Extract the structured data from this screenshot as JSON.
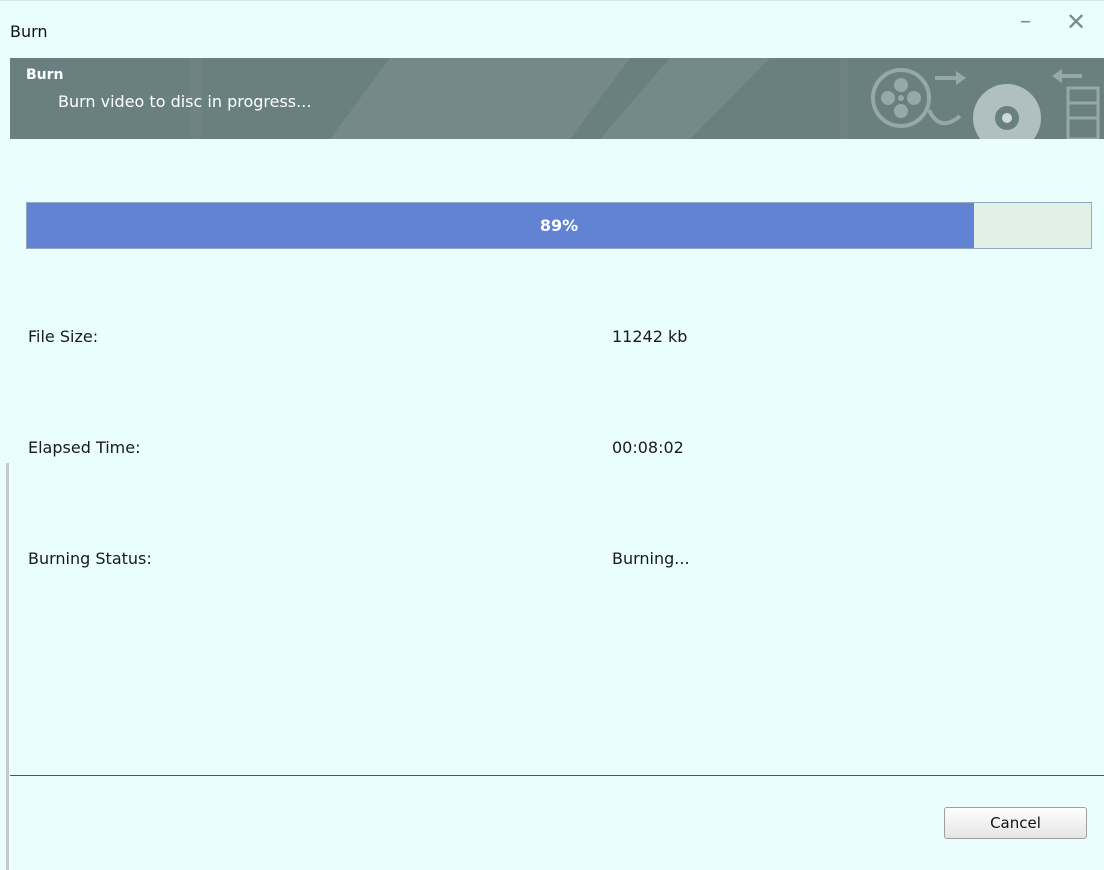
{
  "window": {
    "title": "Burn",
    "minimize_glyph": "–",
    "close_glyph": "✕"
  },
  "banner": {
    "title": "Burn",
    "subtitle": "Burn video to disc in progress..."
  },
  "progress": {
    "value": 0.89,
    "label": "89%"
  },
  "info": {
    "file_size_label": "File Size:",
    "file_size_value": "11242 kb",
    "elapsed_label": "Elapsed Time:",
    "elapsed_value": "00:08:02",
    "status_label": "Burning Status:",
    "status_value": "Burning..."
  },
  "footer": {
    "cancel_label": "Cancel"
  },
  "icons": [
    "film-reel-icon",
    "arrow-right-icon",
    "disc-icon",
    "arrow-left-icon",
    "film-strip-icon"
  ],
  "colors": {
    "progress_fill": "#6282d4",
    "banner_bg": "#6a7f80",
    "window_bg": "#ebfefe"
  }
}
